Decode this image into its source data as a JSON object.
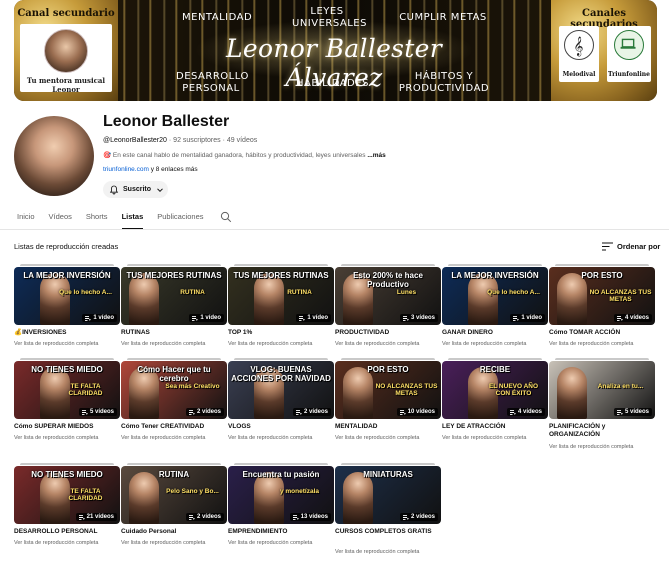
{
  "banner": {
    "left_panel_title": "Canal secundario",
    "left_logo_caption": "Tu mentora musical Leonor",
    "right_panel_title": "Canales secundarios",
    "right_logos": [
      "Melodival",
      "Triunfonline"
    ],
    "words": {
      "mentalidad": "MENTALIDAD",
      "leyes": "LEYES UNIVERSALES",
      "cumplir": "CUMPLIR METAS",
      "desarrollo": "DESARROLLO PERSONAL",
      "habilidades": "HABILIDADES",
      "habitos": "HÁBITOS Y PRODUCTIVIDAD"
    },
    "name": "Leonor Ballester Álvarez",
    "colors": {
      "gold": "#c69b3a",
      "dark": "#0d0a05"
    }
  },
  "channel": {
    "name": "Leonor Ballester",
    "handle": "@LeonorBallester20",
    "subscribers": "92 suscriptores",
    "videos": "49 vídeos",
    "description": "En este canal hablo de mentalidad ganadora, hábitos y productividad, leyes universales",
    "more": "...más",
    "link": "triunfonline.com",
    "links_more": "y 8 enlaces más",
    "subscribe_label": "Suscrito"
  },
  "tabs": [
    {
      "label": "Inicio"
    },
    {
      "label": "Vídeos"
    },
    {
      "label": "Shorts"
    },
    {
      "label": "Listas",
      "active": true
    },
    {
      "label": "Publicaciones"
    }
  ],
  "section": {
    "title": "Listas de reproducción creadas",
    "sort_label": "Ordenar por"
  },
  "playlists": [
    {
      "title": "💰INVERSIONES",
      "sub": "Ver lista de reproducción completa",
      "count": "1 vídeo",
      "caption": "LA MEJOR INVERSIÓN",
      "sub_caption": "Que lo hecho A...",
      "bg": "#0d2b57"
    },
    {
      "title": "RUTINAS",
      "sub": "Ver lista de reproducción completa",
      "count": "1 vídeo",
      "caption": "TUS MEJORES RUTINAS",
      "sub_caption": "RUTINA",
      "bg": "#3a3a2a"
    },
    {
      "title": "TOP 1%",
      "sub": "Ver lista de reproducción completa",
      "count": "1 vídeo",
      "caption": "TUS MEJORES RUTINAS",
      "sub_caption": "RUTINA",
      "bg": "#33301f"
    },
    {
      "title": "PRODUCTIVIDAD",
      "sub": "Ver lista de reproducción completa",
      "count": "3 vídeos",
      "caption": "Esto 200% te hace Productivo",
      "sub_caption": "Lunes",
      "bg": "#4a3f35"
    },
    {
      "title": "GANAR DINERO",
      "sub": "Ver lista de reproducción completa",
      "count": "1 vídeo",
      "caption": "LA MEJOR INVERSIÓN",
      "sub_caption": "Que lo hecho A...",
      "bg": "#0d2b57"
    },
    {
      "title": "Cómo TOMAR ACCIÓN",
      "sub": "Ver lista de reproducción completa",
      "count": "4 vídeos",
      "caption": "POR ESTO",
      "sub_caption": "NO ALCANZAS TUS METAS",
      "bg": "#5a2e1e"
    },
    {
      "title": "Cómo SUPERAR MIEDOS",
      "sub": "Ver lista de reproducción completa",
      "count": "5 vídeos",
      "caption": "NO TIENES MIEDO",
      "sub_caption": "TE FALTA CLARIDAD",
      "bg": "#7a2a2a"
    },
    {
      "title": "Cómo Tener CREATIVIDAD",
      "sub": "Ver lista de reproducción completa",
      "count": "2 vídeos",
      "caption": "Cómo Hacer que tu cerebro",
      "sub_caption": "Sea más Creativo",
      "bg": "#b0473a"
    },
    {
      "title": "VLOGS",
      "sub": "Ver lista de reproducción completa",
      "count": "2 vídeos",
      "caption": "VLOG: BUENAS ACCIONES POR NAVIDAD",
      "sub_caption": "",
      "bg": "#3a3f52"
    },
    {
      "title": "MENTALIDAD",
      "sub": "Ver lista de reproducción completa",
      "count": "10 vídeos",
      "caption": "POR ESTO",
      "sub_caption": "NO ALCANZAS TUS METAS",
      "bg": "#5a2e1e"
    },
    {
      "title": "LEY DE ATRACCIÓN",
      "sub": "Ver lista de reproducción completa",
      "count": "4 vídeos",
      "caption": "RECIBE",
      "sub_caption": "EL NUEVO AÑO CON ÉXITO",
      "bg": "#4a1f5a"
    },
    {
      "title": "PLANIFICACIÓN y ORGANIZACIÓN",
      "sub": "Ver lista de reproducción completa",
      "count": "5 vídeos",
      "caption": "",
      "sub_caption": "Analiza en tu...",
      "bg": "#c9c2b8"
    },
    {
      "title": "DESARROLLO PERSONAL",
      "sub": "Ver lista de reproducción completa",
      "count": "21 vídeos",
      "caption": "NO TIENES MIEDO",
      "sub_caption": "TE FALTA CLARIDAD",
      "bg": "#7a2a2a"
    },
    {
      "title": "Cuidado Personal",
      "sub": "Ver lista de reproducción completa",
      "count": "2 vídeos",
      "caption": "RUTINA",
      "sub_caption": "Pelo Sano y Bo...",
      "bg": "#5a4a3e"
    },
    {
      "title": "EMPRENDIMIENTO",
      "sub": "Ver lista de reproducción completa",
      "count": "13 vídeos",
      "caption": "Encuentra tu pasión",
      "sub_caption": "y monetízala",
      "bg": "#2a1f4a"
    },
    {
      "title": "CURSOS COMPLETOS GRATIS",
      "sub": "Ver lista de reproducción completa",
      "count": "2 vídeos",
      "caption": "MINIATURAS",
      "sub_caption": "",
      "bg": "#1d2f4a"
    }
  ]
}
